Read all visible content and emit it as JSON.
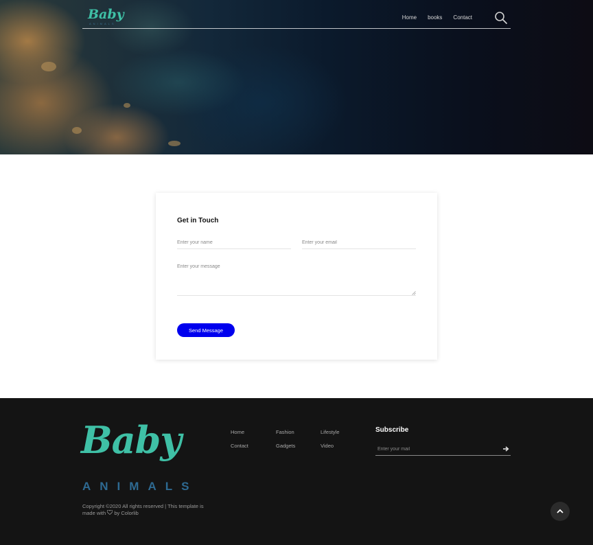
{
  "header": {
    "logo_text": "Baby",
    "logo_subtext": "ANIMALS",
    "nav": [
      {
        "label": "Home"
      },
      {
        "label": "books"
      },
      {
        "label": "Contact"
      }
    ],
    "search_icon": "search-icon"
  },
  "contact": {
    "title": "Get in Touch",
    "name_placeholder": "Enter your name",
    "email_placeholder": "Enter your email",
    "message_placeholder": "Enter your message",
    "send_label": "Send Message",
    "button_color": "#0000ee"
  },
  "footer": {
    "logo_text": "Baby",
    "logo_subtext": "ANIMALS",
    "copyright_prefix": "Copyright ©2020 All rights reserved | This template is made with",
    "copyright_suffix": "by Colorlib",
    "heart_icon": "heart-icon",
    "links": [
      {
        "label": "Home"
      },
      {
        "label": "Fashion"
      },
      {
        "label": "Lifestyle"
      },
      {
        "label": "Contact"
      },
      {
        "label": "Gadgets"
      },
      {
        "label": "Video"
      }
    ],
    "subscribe_title": "Subscribe",
    "subscribe_placeholder": "Enter your mail",
    "subscribe_icon": "arrow-right-icon",
    "to_top_icon": "chevron-up-icon"
  },
  "colors": {
    "brand_teal": "#3fc0a6",
    "brand_blue": "#2e6a92",
    "footer_bg": "#141414"
  }
}
